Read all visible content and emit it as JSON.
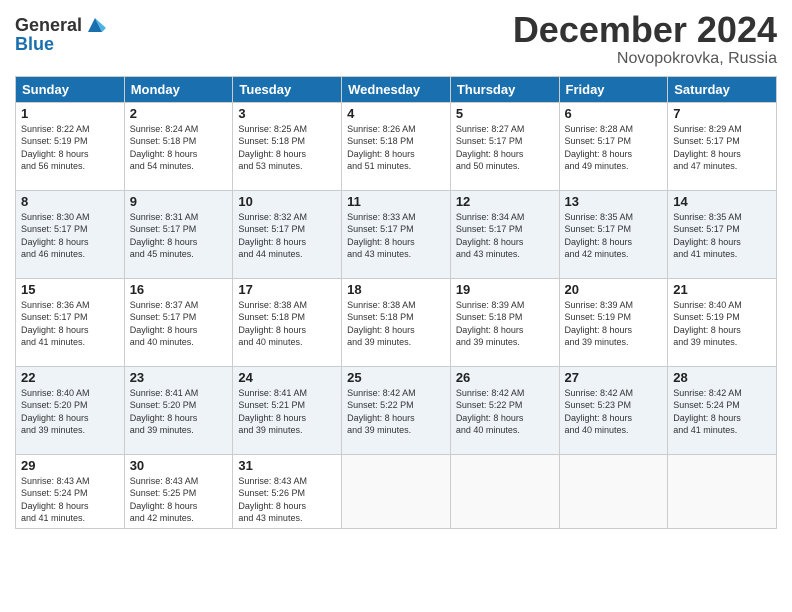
{
  "header": {
    "logo_line1": "General",
    "logo_line2": "Blue",
    "month": "December 2024",
    "location": "Novopokrovka, Russia"
  },
  "weekdays": [
    "Sunday",
    "Monday",
    "Tuesday",
    "Wednesday",
    "Thursday",
    "Friday",
    "Saturday"
  ],
  "weeks": [
    [
      {
        "day": "1",
        "info": "Sunrise: 8:22 AM\nSunset: 5:19 PM\nDaylight: 8 hours\nand 56 minutes."
      },
      {
        "day": "2",
        "info": "Sunrise: 8:24 AM\nSunset: 5:18 PM\nDaylight: 8 hours\nand 54 minutes."
      },
      {
        "day": "3",
        "info": "Sunrise: 8:25 AM\nSunset: 5:18 PM\nDaylight: 8 hours\nand 53 minutes."
      },
      {
        "day": "4",
        "info": "Sunrise: 8:26 AM\nSunset: 5:18 PM\nDaylight: 8 hours\nand 51 minutes."
      },
      {
        "day": "5",
        "info": "Sunrise: 8:27 AM\nSunset: 5:17 PM\nDaylight: 8 hours\nand 50 minutes."
      },
      {
        "day": "6",
        "info": "Sunrise: 8:28 AM\nSunset: 5:17 PM\nDaylight: 8 hours\nand 49 minutes."
      },
      {
        "day": "7",
        "info": "Sunrise: 8:29 AM\nSunset: 5:17 PM\nDaylight: 8 hours\nand 47 minutes."
      }
    ],
    [
      {
        "day": "8",
        "info": "Sunrise: 8:30 AM\nSunset: 5:17 PM\nDaylight: 8 hours\nand 46 minutes."
      },
      {
        "day": "9",
        "info": "Sunrise: 8:31 AM\nSunset: 5:17 PM\nDaylight: 8 hours\nand 45 minutes."
      },
      {
        "day": "10",
        "info": "Sunrise: 8:32 AM\nSunset: 5:17 PM\nDaylight: 8 hours\nand 44 minutes."
      },
      {
        "day": "11",
        "info": "Sunrise: 8:33 AM\nSunset: 5:17 PM\nDaylight: 8 hours\nand 43 minutes."
      },
      {
        "day": "12",
        "info": "Sunrise: 8:34 AM\nSunset: 5:17 PM\nDaylight: 8 hours\nand 43 minutes."
      },
      {
        "day": "13",
        "info": "Sunrise: 8:35 AM\nSunset: 5:17 PM\nDaylight: 8 hours\nand 42 minutes."
      },
      {
        "day": "14",
        "info": "Sunrise: 8:35 AM\nSunset: 5:17 PM\nDaylight: 8 hours\nand 41 minutes."
      }
    ],
    [
      {
        "day": "15",
        "info": "Sunrise: 8:36 AM\nSunset: 5:17 PM\nDaylight: 8 hours\nand 41 minutes."
      },
      {
        "day": "16",
        "info": "Sunrise: 8:37 AM\nSunset: 5:17 PM\nDaylight: 8 hours\nand 40 minutes."
      },
      {
        "day": "17",
        "info": "Sunrise: 8:38 AM\nSunset: 5:18 PM\nDaylight: 8 hours\nand 40 minutes."
      },
      {
        "day": "18",
        "info": "Sunrise: 8:38 AM\nSunset: 5:18 PM\nDaylight: 8 hours\nand 39 minutes."
      },
      {
        "day": "19",
        "info": "Sunrise: 8:39 AM\nSunset: 5:18 PM\nDaylight: 8 hours\nand 39 minutes."
      },
      {
        "day": "20",
        "info": "Sunrise: 8:39 AM\nSunset: 5:19 PM\nDaylight: 8 hours\nand 39 minutes."
      },
      {
        "day": "21",
        "info": "Sunrise: 8:40 AM\nSunset: 5:19 PM\nDaylight: 8 hours\nand 39 minutes."
      }
    ],
    [
      {
        "day": "22",
        "info": "Sunrise: 8:40 AM\nSunset: 5:20 PM\nDaylight: 8 hours\nand 39 minutes."
      },
      {
        "day": "23",
        "info": "Sunrise: 8:41 AM\nSunset: 5:20 PM\nDaylight: 8 hours\nand 39 minutes."
      },
      {
        "day": "24",
        "info": "Sunrise: 8:41 AM\nSunset: 5:21 PM\nDaylight: 8 hours\nand 39 minutes."
      },
      {
        "day": "25",
        "info": "Sunrise: 8:42 AM\nSunset: 5:22 PM\nDaylight: 8 hours\nand 39 minutes."
      },
      {
        "day": "26",
        "info": "Sunrise: 8:42 AM\nSunset: 5:22 PM\nDaylight: 8 hours\nand 40 minutes."
      },
      {
        "day": "27",
        "info": "Sunrise: 8:42 AM\nSunset: 5:23 PM\nDaylight: 8 hours\nand 40 minutes."
      },
      {
        "day": "28",
        "info": "Sunrise: 8:42 AM\nSunset: 5:24 PM\nDaylight: 8 hours\nand 41 minutes."
      }
    ],
    [
      {
        "day": "29",
        "info": "Sunrise: 8:43 AM\nSunset: 5:24 PM\nDaylight: 8 hours\nand 41 minutes."
      },
      {
        "day": "30",
        "info": "Sunrise: 8:43 AM\nSunset: 5:25 PM\nDaylight: 8 hours\nand 42 minutes."
      },
      {
        "day": "31",
        "info": "Sunrise: 8:43 AM\nSunset: 5:26 PM\nDaylight: 8 hours\nand 43 minutes."
      },
      {
        "day": "",
        "info": ""
      },
      {
        "day": "",
        "info": ""
      },
      {
        "day": "",
        "info": ""
      },
      {
        "day": "",
        "info": ""
      }
    ]
  ]
}
